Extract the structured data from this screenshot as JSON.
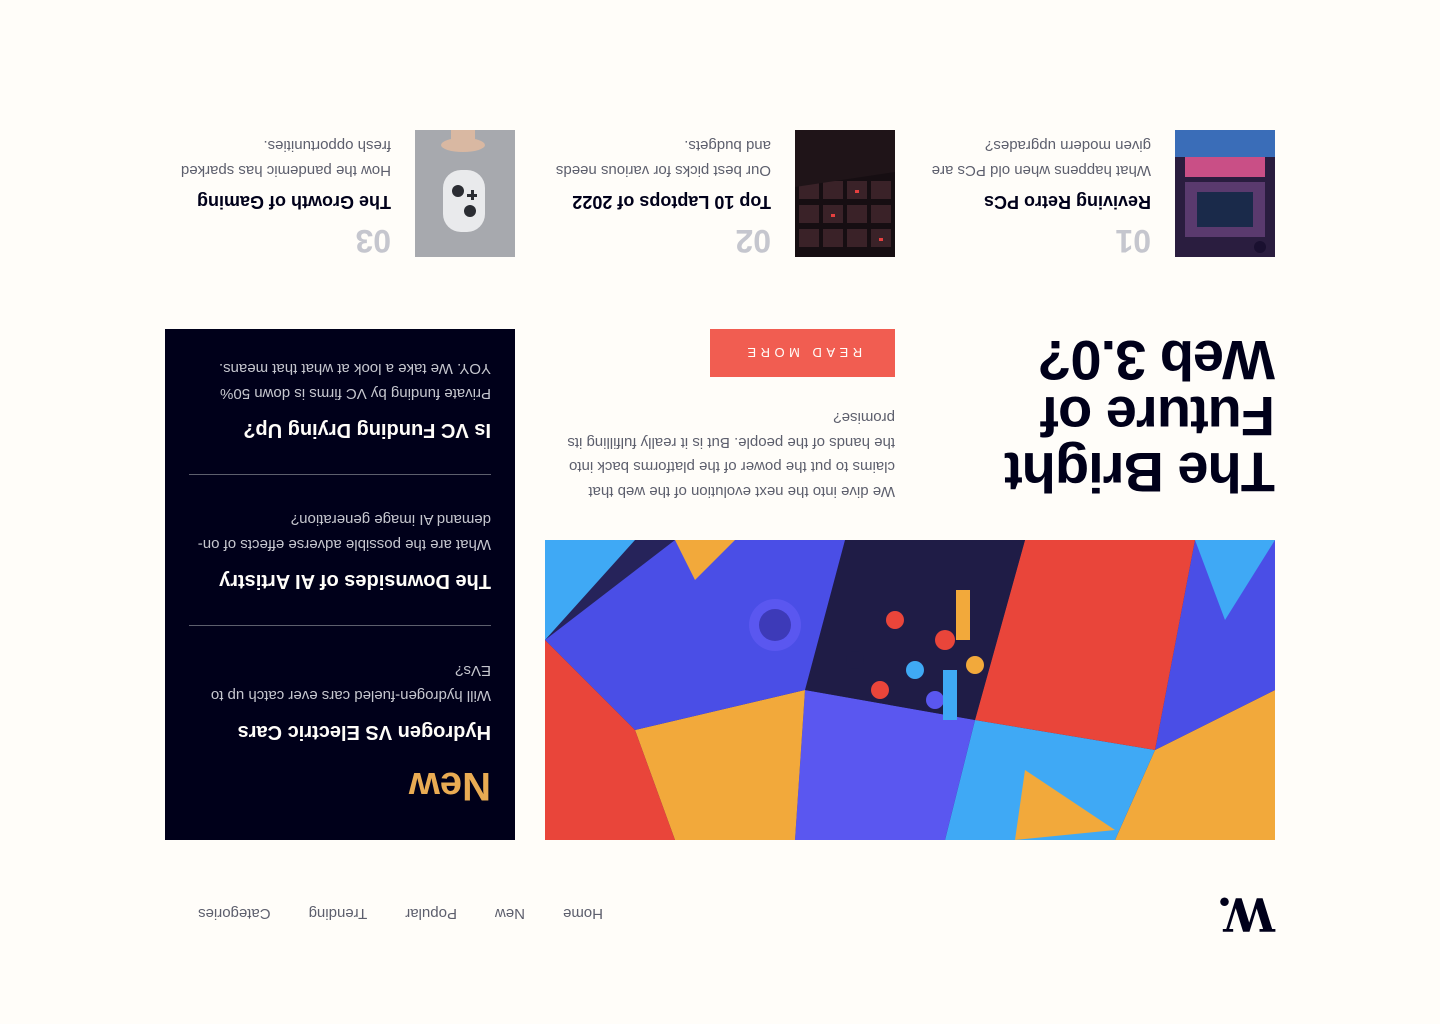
{
  "header": {
    "logo": "W.",
    "nav": [
      "Home",
      "New",
      "Popular",
      "Trending",
      "Categories"
    ]
  },
  "hero": {
    "title": "The Bright Future of Web 3.0?",
    "description": "We dive into the next evolution of the web that claims to put the power of the platforms back into the hands of the people. But is it really fulfilling its promise?",
    "cta": "Read more"
  },
  "new_panel": {
    "heading": "New",
    "items": [
      {
        "title": "Hydrogen VS Electric Cars",
        "desc": "Will hydrogen-fueled cars ever catch up to EVs?"
      },
      {
        "title": "The Downsides of AI Artistry",
        "desc": "What are the possible adverse effects of on-demand AI image generation?"
      },
      {
        "title": "Is VC Funding Drying Up?",
        "desc": "Private funding by VC firms is down 50% YOY. We take a look at what that means."
      }
    ]
  },
  "articles": [
    {
      "num": "01",
      "title": "Reviving Retro PCs",
      "desc": "What happens when old PCs are given modern upgrades?"
    },
    {
      "num": "02",
      "title": "Top 10 Laptops of 2022",
      "desc": "Our best picks for various needs and budgets."
    },
    {
      "num": "03",
      "title": "The Growth of Gaming",
      "desc": "How the pandemic has sparked fresh opportunities."
    }
  ],
  "colors": {
    "background": "#fffdf9",
    "text": "#00001a",
    "accent": "#f15d51",
    "highlight": "#e9ab53",
    "muted": "#5d5f6d"
  }
}
